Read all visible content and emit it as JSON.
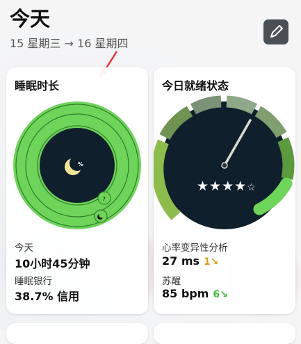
{
  "header": {
    "title": "今天",
    "date_range": "15 星期三 → 16 星期四"
  },
  "sleep_card": {
    "title": "睡眠时长",
    "center_symbol": "%",
    "badge_count": "7",
    "today_label": "今天",
    "today_value": "10小时45分钟",
    "bank_label": "睡眠银行",
    "bank_value": "38.7% 信用",
    "ring_color": "#6ed45a",
    "inner_color": "#0f1f2c"
  },
  "readiness_card": {
    "title": "今日就绪状态",
    "stars_filled": 4,
    "stars_total": 5,
    "hrv_label": "心率变异性分析",
    "hrv_value": "27 ms",
    "hrv_change": "1↘",
    "awake_label": "苏醒",
    "awake_value": "85 bpm",
    "awake_change": "6↘",
    "gauge_color": "#6ed45a"
  },
  "icons": {
    "edit": "edit-pencil-icon",
    "moon": "moon-icon",
    "annotation": "red-arrow-icon"
  }
}
